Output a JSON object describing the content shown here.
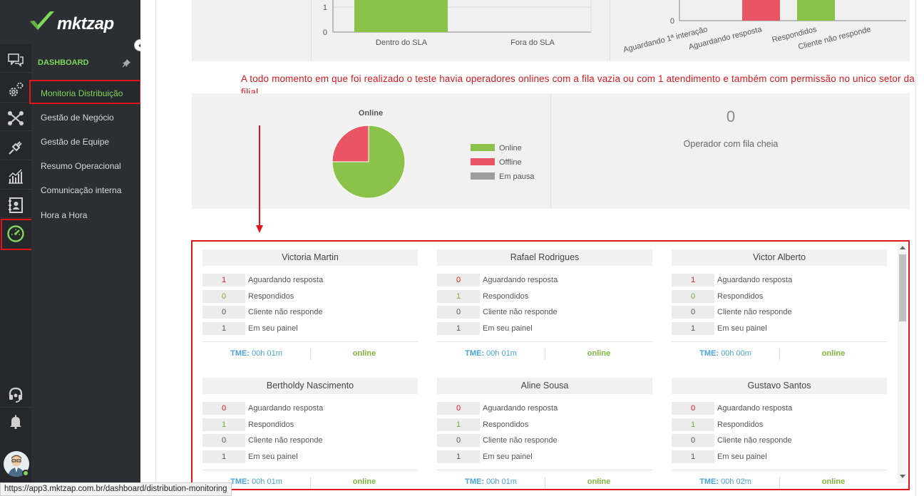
{
  "app": {
    "logo_text": "mktzap"
  },
  "nav": {
    "section_title": "DASHBOARD",
    "items": [
      {
        "label": "Monitoria Distribuição",
        "active": true
      },
      {
        "label": "Gestão de Negócio"
      },
      {
        "label": "Gestão de Equipe"
      },
      {
        "label": "Resumo Operacional"
      },
      {
        "label": "Comunicação interna"
      },
      {
        "label": "Hora a Hora"
      }
    ]
  },
  "rail_icons": [
    "chat-icon",
    "settings-gear-icon",
    "flow-network-icon",
    "plug-icon",
    "bar-chart-icon",
    "contacts-book-icon",
    "speedometer-icon",
    "headset-icon",
    "bell-icon",
    "user-avatar"
  ],
  "sla_chart": {
    "categories": [
      "Dentro do SLA",
      "Fora do SLA"
    ],
    "ticks": [
      "1",
      "0"
    ]
  },
  "status_chart": {
    "categories": [
      "Aguardando 1ª interação",
      "Aguardando resposta",
      "Respondidos",
      "Cliente não responde"
    ],
    "ticks": [
      "0"
    ]
  },
  "note": "A todo momento em que foi realizado o teste havia operadores onlines com a fila vazia ou com 1 atendimento e também com permissão no unico setor da filial.",
  "online_chart": {
    "title": "Online",
    "legend": [
      "Online",
      "Offline",
      "Em pausa"
    ]
  },
  "chart_data": {
    "type": "pie",
    "title": "Online",
    "categories": [
      "Online",
      "Offline",
      "Em pausa"
    ],
    "values": [
      75,
      25,
      0
    ],
    "colors": [
      "#8bc34a",
      "#ea5565",
      "#9e9e9e"
    ]
  },
  "counter": {
    "value": "0",
    "label": "Operador com fila cheia"
  },
  "operators": [
    {
      "name": "Victoria Martin",
      "aguardando": "1",
      "respondidos": "0",
      "cliente": "0",
      "painel": "1",
      "tme_label": "TME:",
      "tme": "00h 01m",
      "status": "online"
    },
    {
      "name": "Rafael Rodrigues",
      "aguardando": "0",
      "respondidos": "1",
      "cliente": "0",
      "painel": "1",
      "tme_label": "TME:",
      "tme": "00h 01m",
      "status": "online"
    },
    {
      "name": "Victor Alberto",
      "aguardando": "1",
      "respondidos": "0",
      "cliente": "0",
      "painel": "1",
      "tme_label": "TME:",
      "tme": "00h 00m",
      "status": "online"
    },
    {
      "name": "Bertholdy Nascimento",
      "aguardando": "0",
      "respondidos": "1",
      "cliente": "0",
      "painel": "1",
      "tme_label": "TME:",
      "tme": "00h 01m",
      "status": "online"
    },
    {
      "name": "Aline Sousa",
      "aguardando": "0",
      "respondidos": "1",
      "cliente": "0",
      "painel": "1",
      "tme_label": "TME:",
      "tme": "00h 01m",
      "status": "online"
    },
    {
      "name": "Gustavo Santos",
      "aguardando": "0",
      "respondidos": "1",
      "cliente": "0",
      "painel": "1",
      "tme_label": "TME:",
      "tme": "00h 02m",
      "status": "online"
    }
  ],
  "row_labels": {
    "aguardando": "Aguardando resposta",
    "respondidos": "Respondidos",
    "cliente": "Cliente não responde",
    "painel": "Em seu painel"
  },
  "status_bar_url": "https://app3.mktzap.com.br/dashboard/distribution-monitoring"
}
